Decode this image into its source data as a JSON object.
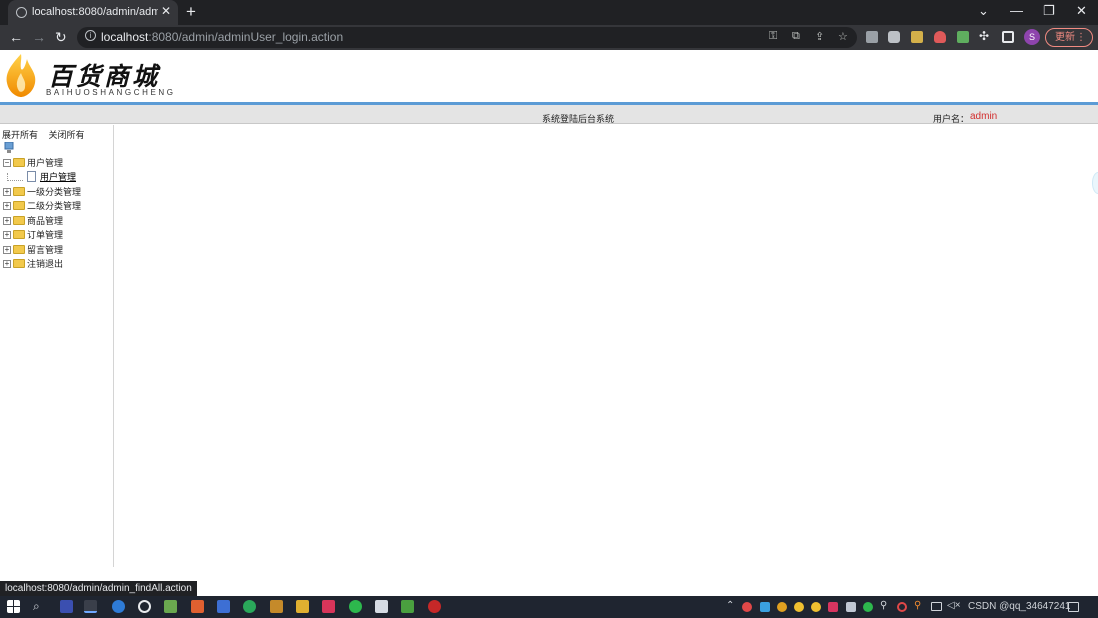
{
  "browser": {
    "tab_title": "localhost:8080/admin/adminU",
    "tab_close": "✕",
    "new_tab": "+",
    "url_host": "localhost",
    "url_rest": ":8080/admin/adminUser_login.action",
    "update_label": "更新",
    "profile_initial": "S",
    "status_url": "localhost:8080/admin/admin_findAll.action"
  },
  "header": {
    "logo_cn": "百货商城",
    "logo_en": "BAIHUOSHANGCHENG",
    "system_title": "系统登陆后台系统",
    "user_label": "用户名：",
    "username": "admin"
  },
  "tree": {
    "expand_all": "展开所有",
    "collapse_all": "关闭所有",
    "nodes": [
      {
        "label": "用户管理",
        "expanded": true
      },
      {
        "label": "一级分类管理"
      },
      {
        "label": "二级分类管理"
      },
      {
        "label": "商品管理"
      },
      {
        "label": "订单管理"
      },
      {
        "label": "留言管理"
      },
      {
        "label": "注销退出"
      }
    ],
    "child_label": "用户管理"
  },
  "taskbar": {
    "watermark": "CSDN @qq_34647241"
  },
  "colors": {
    "accent_blue": "#5b9bd5",
    "username_red": "#d32f2f",
    "chrome_dark": "#202124"
  }
}
